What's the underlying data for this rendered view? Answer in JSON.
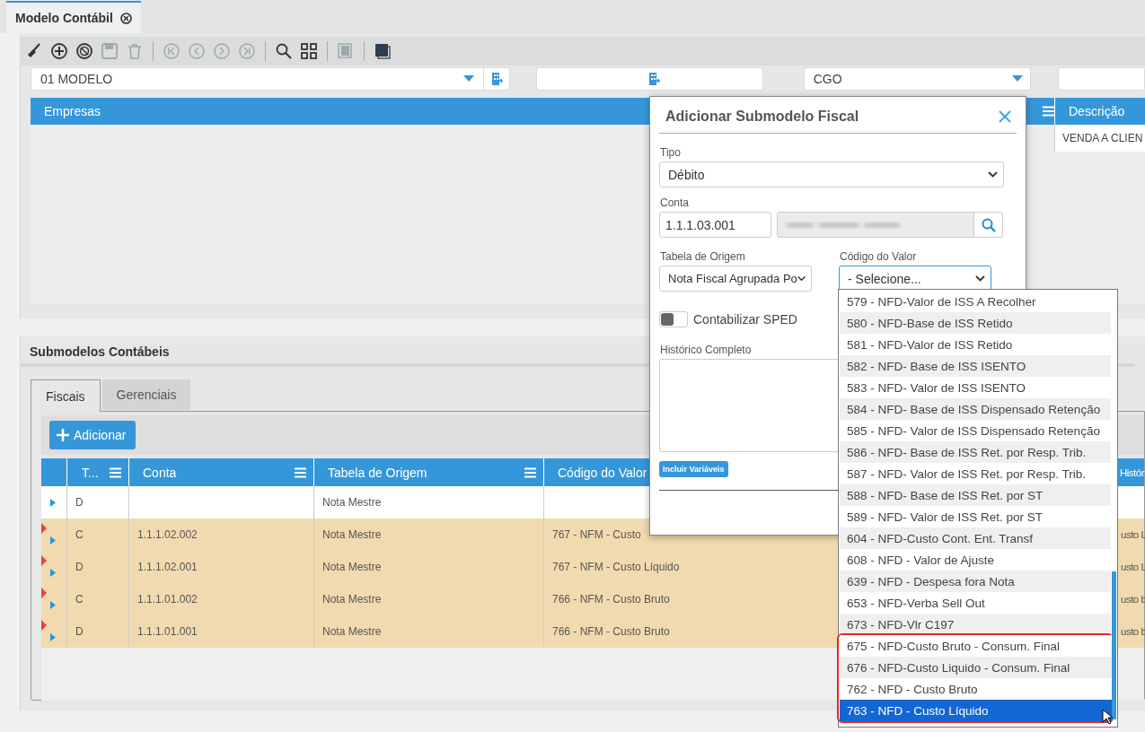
{
  "tab": {
    "title": "Modelo Contábil",
    "selected": true
  },
  "toolbar": [
    {
      "kind": "broom",
      "disabled": false
    },
    {
      "kind": "add",
      "disabled": false
    },
    {
      "kind": "cancel",
      "disabled": false
    },
    {
      "kind": "save",
      "disabled": true
    },
    {
      "kind": "delete",
      "disabled": true
    },
    {
      "kind": "separator"
    },
    {
      "kind": "first",
      "disabled": true
    },
    {
      "kind": "previous",
      "disabled": true
    },
    {
      "kind": "next",
      "disabled": true
    },
    {
      "kind": "last",
      "disabled": true
    },
    {
      "kind": "separator"
    },
    {
      "kind": "search",
      "disabled": false
    },
    {
      "kind": "grid",
      "disabled": false
    },
    {
      "kind": "separator"
    },
    {
      "kind": "copy",
      "disabled": true
    },
    {
      "kind": "separator"
    },
    {
      "kind": "layers",
      "disabled": false
    }
  ],
  "form": {
    "modelo": "01 MODELO",
    "cgo": "CGO"
  },
  "empresas_grid": {
    "title": "Empresas",
    "description_header": "Descrição",
    "rows": [
      {
        "descricao": "VENDA A CLIEN"
      }
    ]
  },
  "submodelos": {
    "title": "Submodelos Contábeis",
    "tabs": [
      {
        "label": "Fiscais",
        "selected": true
      },
      {
        "label": "Gerenciais",
        "selected": false
      }
    ],
    "add_button": "Adicionar",
    "columns": [
      "T...",
      "Conta",
      "Tabela de Origem",
      "Código do Valor",
      "Histór"
    ],
    "rows": [
      {
        "tipo": "D",
        "tabela": "Nota Mestre",
        "modified": false
      },
      {
        "tipo": "C",
        "conta": "1.1.1.02.002",
        "tabela": "Nota Mestre",
        "codigo": "767 - NFM - Custo",
        "column_5": "usto L",
        "modified": true
      },
      {
        "tipo": "D",
        "conta": "1.1.1.02.001",
        "tabela": "Nota Mestre",
        "codigo": "767 - NFM - Custo Líquido",
        "column_5": "usto L",
        "modified": true
      },
      {
        "tipo": "C",
        "conta": "1.1.1.01.002",
        "tabela": "Nota Mestre",
        "codigo": "766 - NFM - Custo Bruto",
        "column_5": "usto b",
        "modified": true
      },
      {
        "tipo": "D",
        "conta": "1.1.1.01.001",
        "tabela": "Nota Mestre",
        "codigo": "766 - NFM - Custo Bruto",
        "column_5": "usto b",
        "modified": true
      }
    ]
  },
  "dialog": {
    "title": "Adicionar Submodelo Fiscal",
    "tipo": {
      "label": "Tipo",
      "value": "Débito"
    },
    "conta": {
      "label": "Conta",
      "value": "1.1.1.03.001"
    },
    "tabela": {
      "label": "Tabela de Origem",
      "value": "Nota Fiscal Agrupada Po"
    },
    "codigo": {
      "label": "Código do Valor",
      "value": "- Selecione..."
    },
    "sped": {
      "label": "Contabilizar SPED",
      "on": false
    },
    "historico": {
      "label": "Histórico Completo"
    },
    "variables_button": "Incluir Variáveis",
    "options": [
      {
        "label": "579 - NFD-Valor de ISS A Recolher",
        "selected": false,
        "highlighted": false
      },
      {
        "label": "580 - NFD-Base de ISS Retido",
        "selected": false,
        "highlighted": false
      },
      {
        "label": "581 - NFD-Valor de ISS Retido",
        "selected": false,
        "highlighted": false
      },
      {
        "label": "582 - NFD- Base de ISS ISENTO",
        "selected": false,
        "highlighted": false
      },
      {
        "label": "583 - NFD- Valor de ISS ISENTO",
        "selected": false,
        "highlighted": false
      },
      {
        "label": "584 - NFD- Base de ISS Dispensado Retenção",
        "selected": false,
        "highlighted": false
      },
      {
        "label": "585 - NFD- Valor de ISS Dispensado Retenção",
        "selected": false,
        "highlighted": false
      },
      {
        "label": "586 - NFD- Base de ISS Ret. por Resp. Trib.",
        "selected": false,
        "highlighted": false
      },
      {
        "label": "587 - NFD- Valor de ISS Ret. por Resp. Trib.",
        "selected": false,
        "highlighted": false
      },
      {
        "label": "588 - NFD- Base de ISS Ret. por ST",
        "selected": false,
        "highlighted": false
      },
      {
        "label": "589 - NFD- Valor de ISS Ret. por ST",
        "selected": false,
        "highlighted": false
      },
      {
        "label": "604 - NFD-Custo Cont. Ent. Transf",
        "selected": false,
        "highlighted": false
      },
      {
        "label": "608 - NFD - Valor de Ajuste",
        "selected": false,
        "highlighted": false
      },
      {
        "label": "639 - NFD - Despesa fora Nota",
        "selected": false,
        "highlighted": false
      },
      {
        "label": "653 - NFD-Verba Sell Out",
        "selected": false,
        "highlighted": false
      },
      {
        "label": "673 - NFD-Vlr C197",
        "selected": false,
        "highlighted": false
      },
      {
        "label": "675 - NFD-Custo Bruto - Consum. Final",
        "selected": false,
        "highlighted": true
      },
      {
        "label": "676 - NFD-Custo Liquido - Consum. Final",
        "selected": false,
        "highlighted": true
      },
      {
        "label": "762 - NFD - Custo Bruto",
        "selected": false,
        "highlighted": true
      },
      {
        "label": "763 - NFD - Custo Líquido",
        "selected": true,
        "highlighted": true
      }
    ]
  }
}
